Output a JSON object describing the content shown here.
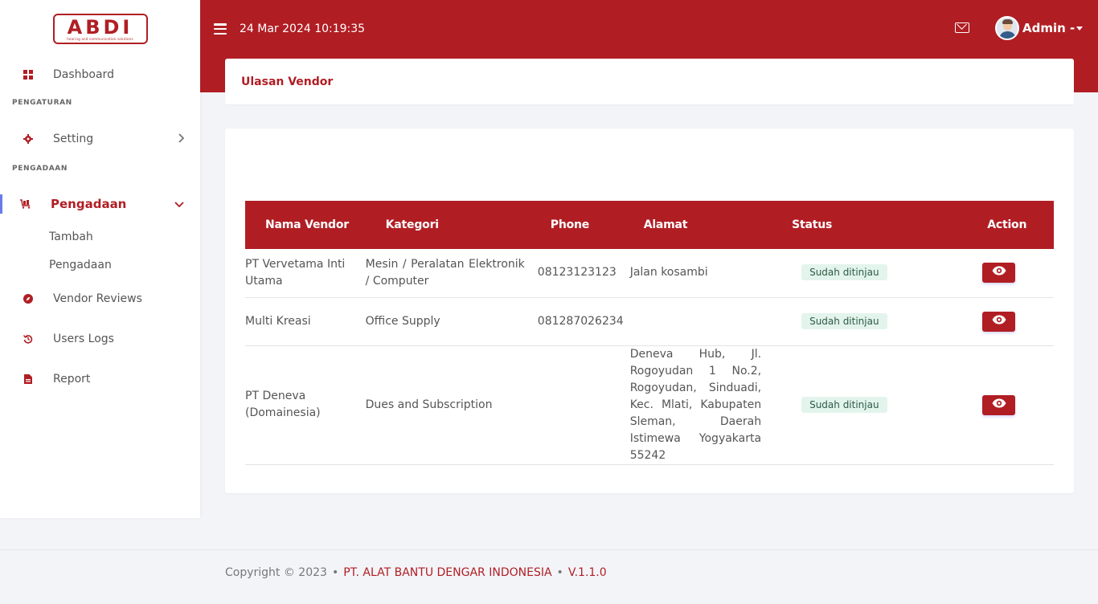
{
  "brand": {
    "logo_text": "ABDI",
    "logo_tagline": "hearing and communication solutions"
  },
  "header": {
    "datetime": "24 Mar 2024 10:19:35",
    "user_name": "Admin -"
  },
  "sidebar": {
    "dashboard": "Dashboard",
    "heading_settings": "PENGATURAN",
    "setting": "Setting",
    "heading_procurement": "PENGADAAN",
    "pengadaan": "Pengadaan",
    "sub_tambah": "Tambah",
    "sub_pengadaan": "Pengadaan",
    "vendor_reviews": "Vendor Reviews",
    "users_logs": "Users Logs",
    "report": "Report"
  },
  "breadcrumb": {
    "title": "Ulasan Vendor"
  },
  "table": {
    "headers": [
      "Nama Vendor",
      "Kategori",
      "Phone",
      "Alamat",
      "Status",
      "Action"
    ],
    "rows": [
      {
        "vendor": "PT Vervetama Inti Utama",
        "kategori": "Mesin / Peralatan Elektronik / Computer",
        "phone": "08123123123",
        "alamat": "Jalan kosambi",
        "status": "Sudah ditinjau"
      },
      {
        "vendor": "Multi Kreasi",
        "kategori": "Office Supply",
        "phone": "081287026234",
        "alamat": "",
        "status": "Sudah ditinjau"
      },
      {
        "vendor": "PT Deneva (Domainesia)",
        "kategori": "Dues and Subscription",
        "phone": "",
        "alamat": "Deneva Hub, Jl. Rogoyudan 1 No.2, Rogoyudan, Sinduadi, Kec. Mlati, Kabupaten Sleman, Daerah Istimewa Yogyakarta 55242",
        "status": "Sudah ditinjau"
      }
    ]
  },
  "footer": {
    "copyright": "Copyright © 2023",
    "company": "PT. ALAT BANTU DENGAR INDONESIA",
    "version": "V.1.1.0"
  },
  "colors": {
    "primary": "#b01e24",
    "status_bg": "#e3f4ec"
  }
}
